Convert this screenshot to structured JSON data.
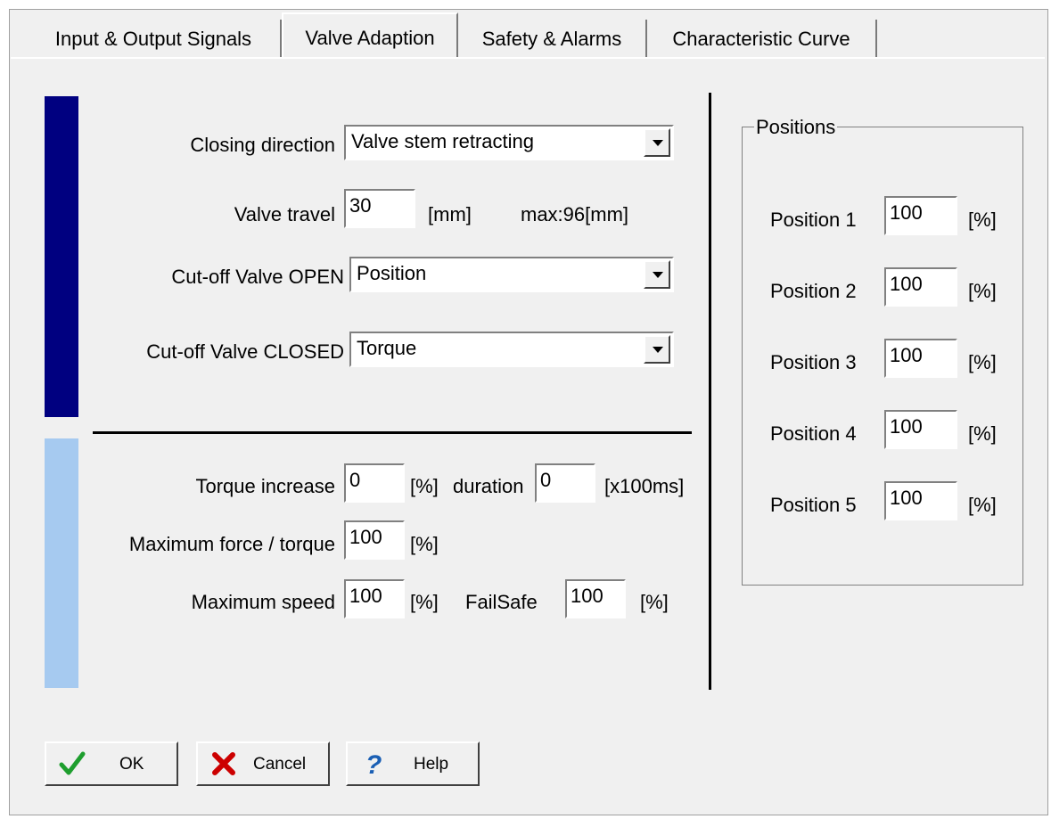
{
  "tabs": [
    {
      "label": "Input & Output Signals"
    },
    {
      "label": "Valve Adaption"
    },
    {
      "label": "Safety & Alarms"
    },
    {
      "label": "Characteristic Curve"
    }
  ],
  "closing_direction": {
    "label": "Closing direction",
    "value": "Valve stem retracting"
  },
  "valve_travel": {
    "label": "Valve travel",
    "value": "30",
    "unit": "[mm]",
    "max": "max:96[mm]"
  },
  "cutoff_open": {
    "label": "Cut-off Valve OPEN",
    "value": "Position"
  },
  "cutoff_closed": {
    "label": "Cut-off Valve CLOSED",
    "value": "Torque"
  },
  "torque_increase": {
    "label": "Torque increase",
    "value": "0",
    "unit": "[%]",
    "duration_label": "duration",
    "duration_value": "0",
    "duration_unit": "[x100ms]"
  },
  "max_force": {
    "label": "Maximum force / torque",
    "value": "100",
    "unit": "[%]"
  },
  "max_speed": {
    "label": "Maximum speed",
    "value": "100",
    "unit": "[%]",
    "failsafe_label": "FailSafe",
    "failsafe_value": "100",
    "failsafe_unit": "[%]"
  },
  "positions": {
    "title": "Positions",
    "items": [
      {
        "label": "Position 1",
        "value": "100",
        "unit": "[%]"
      },
      {
        "label": "Position 2",
        "value": "100",
        "unit": "[%]"
      },
      {
        "label": "Position 3",
        "value": "100",
        "unit": "[%]"
      },
      {
        "label": "Position 4",
        "value": "100",
        "unit": "[%]"
      },
      {
        "label": "Position 5",
        "value": "100",
        "unit": "[%]"
      }
    ]
  },
  "buttons": {
    "ok": "OK",
    "cancel": "Cancel",
    "help": "Help"
  },
  "colors": {
    "bar_dark": "#000080",
    "bar_light": "#a6caf0",
    "ok_check": "#1e9e2e",
    "cancel_x": "#cc0000",
    "help_q": "#1a5fb4"
  }
}
